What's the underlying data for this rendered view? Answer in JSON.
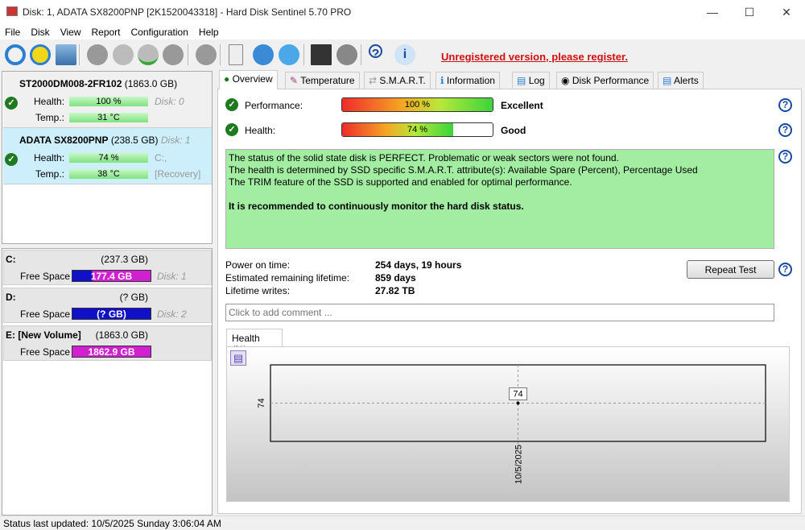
{
  "window": {
    "title": "Disk: 1, ADATA SX8200PNP [2K1520043318]  -  Hard Disk Sentinel 5.70 PRO",
    "minimize": "—",
    "maximize": "☐",
    "close": "✕"
  },
  "menu": [
    "File",
    "Disk",
    "View",
    "Report",
    "Configuration",
    "Help"
  ],
  "toolbar": {
    "register_text": "Unregistered version, please register.",
    "icons": [
      "refresh-icon",
      "alert-icon",
      "disk-icon",
      "disk-gray-icon",
      "disk-check-icon",
      "disk-ok-icon",
      "disk-gray2-icon",
      "blob-icon",
      "report-icon",
      "mail-icon",
      "network-icon",
      "monitor-icon",
      "speaker-icon",
      "help-icon",
      "info-icon"
    ]
  },
  "disks": [
    {
      "name": "ST2000DM008-2FR102",
      "size": "(1863.0 GB)",
      "health_label": "Health:",
      "health": "100 %",
      "temp_label": "Temp.:",
      "temp": "31 °C",
      "disk": "Disk: 0",
      "extra1": "",
      "extra2": ""
    },
    {
      "name": "ADATA SX8200PNP",
      "size": "(238.5 GB)",
      "health_label": "Health:",
      "health": "74 %",
      "temp_label": "Temp.:",
      "temp": "38 °C",
      "disk": "Disk: 1",
      "extra1": "C:,",
      "extra2": "[Recovery]"
    }
  ],
  "volumes": [
    {
      "name": "C:",
      "size": "(237.3 GB)",
      "free_label": "Free Space",
      "free": "177.4 GB",
      "disk": "Disk: 1",
      "free_fraction": 0.75
    },
    {
      "name": "D:",
      "size": "(? GB)",
      "free_label": "Free Space",
      "free": "(? GB)",
      "disk": "Disk: 2",
      "free_fraction": 0
    },
    {
      "name": "E: [New Volume]",
      "size": "(1863.0 GB)",
      "free_label": "Free Space",
      "free": "1862.9 GB",
      "disk": "",
      "free_fraction": 1
    }
  ],
  "tabs": [
    "Overview",
    "Temperature",
    "S.M.A.R.T.",
    "Information",
    "Log",
    "Disk Performance",
    "Alerts"
  ],
  "overview": {
    "performance_label": "Performance:",
    "performance": "100 %",
    "performance_value": 100,
    "performance_rating": "Excellent",
    "health_label": "Health:",
    "health": "74 %",
    "health_value": 74,
    "health_rating": "Good",
    "status_lines": [
      "The status of the solid state disk is PERFECT. Problematic or weak sectors were not found.",
      "The health is determined by SSD specific S.M.A.R.T. attribute(s):  Available Spare (Percent), Percentage Used",
      "The TRIM feature of the SSD is supported and enabled for optimal performance."
    ],
    "status_bold": "It is recommended to continuously monitor the hard disk status.",
    "power_on_label": "Power on time:",
    "power_on": "254 days, 19 hours",
    "remaining_label": "Estimated remaining lifetime:",
    "remaining": "859 days",
    "writes_label": "Lifetime writes:",
    "writes": "27.82 TB",
    "repeat_test": "Repeat Test",
    "comment_placeholder": "Click to add comment ..."
  },
  "chart_tab": "Health (%)",
  "chart_data": {
    "type": "line",
    "title": "Health (%)",
    "x": [
      "10/5/2025"
    ],
    "values": [
      74
    ],
    "ylabels": [
      "74"
    ],
    "data_labels": [
      "74"
    ]
  },
  "statusbar": "Status last updated: 10/5/2025 Sunday 3:06:04 AM",
  "help": "?"
}
